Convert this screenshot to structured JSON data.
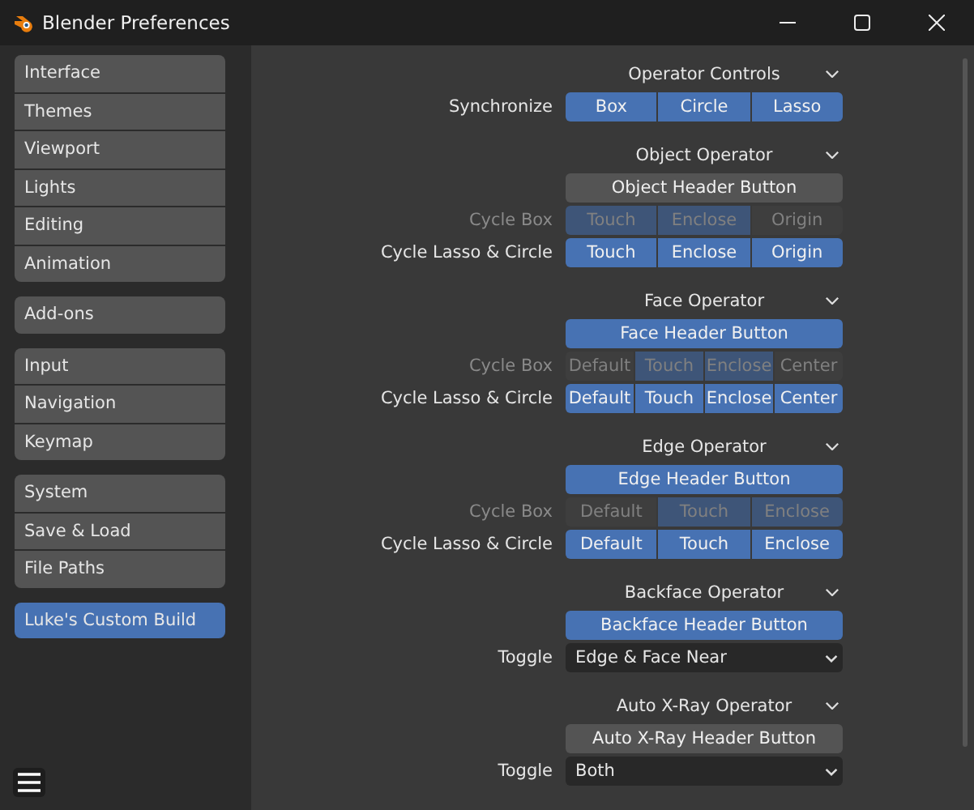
{
  "window": {
    "title": "Blender Preferences"
  },
  "sidebar": {
    "groups": [
      {
        "items": [
          {
            "label": "Interface",
            "selected": false
          },
          {
            "label": "Themes",
            "selected": false
          },
          {
            "label": "Viewport",
            "selected": false
          },
          {
            "label": "Lights",
            "selected": false
          },
          {
            "label": "Editing",
            "selected": false
          },
          {
            "label": "Animation",
            "selected": false
          }
        ]
      },
      {
        "items": [
          {
            "label": "Add-ons",
            "selected": false
          }
        ]
      },
      {
        "items": [
          {
            "label": "Input",
            "selected": false
          },
          {
            "label": "Navigation",
            "selected": false
          },
          {
            "label": "Keymap",
            "selected": false
          }
        ]
      },
      {
        "items": [
          {
            "label": "System",
            "selected": false
          },
          {
            "label": "Save & Load",
            "selected": false
          },
          {
            "label": "File Paths",
            "selected": false
          }
        ]
      },
      {
        "items": [
          {
            "label": "Luke's Custom Build",
            "selected": true
          }
        ]
      }
    ]
  },
  "sections": [
    {
      "title": "Operator Controls",
      "expanded": true,
      "rows": [
        {
          "kind": "segmented",
          "label": "Synchronize",
          "disabled": false,
          "options": [
            {
              "label": "Box",
              "selected": true
            },
            {
              "label": "Circle",
              "selected": true
            },
            {
              "label": "Lasso",
              "selected": true
            }
          ]
        }
      ]
    },
    {
      "title": "Object Operator",
      "expanded": true,
      "rows": [
        {
          "kind": "button",
          "label": "Object Header Button",
          "selected": false
        },
        {
          "kind": "segmented",
          "label": "Cycle Box",
          "disabled": true,
          "options": [
            {
              "label": "Touch",
              "selected": true
            },
            {
              "label": "Enclose",
              "selected": true
            },
            {
              "label": "Origin",
              "selected": false
            }
          ]
        },
        {
          "kind": "segmented",
          "label": "Cycle Lasso & Circle",
          "disabled": false,
          "options": [
            {
              "label": "Touch",
              "selected": true
            },
            {
              "label": "Enclose",
              "selected": true
            },
            {
              "label": "Origin",
              "selected": true
            }
          ]
        }
      ]
    },
    {
      "title": "Face Operator",
      "expanded": true,
      "rows": [
        {
          "kind": "button",
          "label": "Face Header Button",
          "selected": true
        },
        {
          "kind": "segmented",
          "label": "Cycle Box",
          "disabled": true,
          "options": [
            {
              "label": "Default",
              "selected": false
            },
            {
              "label": "Touch",
              "selected": true
            },
            {
              "label": "Enclose",
              "selected": true
            },
            {
              "label": "Center",
              "selected": false
            }
          ]
        },
        {
          "kind": "segmented",
          "label": "Cycle Lasso & Circle",
          "disabled": false,
          "options": [
            {
              "label": "Default",
              "selected": true
            },
            {
              "label": "Touch",
              "selected": true
            },
            {
              "label": "Enclose",
              "selected": true
            },
            {
              "label": "Center",
              "selected": true
            }
          ]
        }
      ]
    },
    {
      "title": "Edge Operator",
      "expanded": true,
      "rows": [
        {
          "kind": "button",
          "label": "Edge Header Button",
          "selected": true
        },
        {
          "kind": "segmented",
          "label": "Cycle Box",
          "disabled": true,
          "options": [
            {
              "label": "Default",
              "selected": false
            },
            {
              "label": "Touch",
              "selected": true
            },
            {
              "label": "Enclose",
              "selected": true
            }
          ]
        },
        {
          "kind": "segmented",
          "label": "Cycle Lasso & Circle",
          "disabled": false,
          "options": [
            {
              "label": "Default",
              "selected": true
            },
            {
              "label": "Touch",
              "selected": true
            },
            {
              "label": "Enclose",
              "selected": true
            }
          ]
        }
      ]
    },
    {
      "title": "Backface Operator",
      "expanded": true,
      "rows": [
        {
          "kind": "button",
          "label": "Backface Header Button",
          "selected": true
        },
        {
          "kind": "dropdown",
          "label": "Toggle",
          "value": "Edge & Face Near"
        }
      ]
    },
    {
      "title": "Auto X-Ray Operator",
      "expanded": true,
      "rows": [
        {
          "kind": "button",
          "label": "Auto X-Ray Header Button",
          "selected": false
        },
        {
          "kind": "dropdown",
          "label": "Toggle",
          "value": "Both"
        }
      ]
    }
  ]
}
